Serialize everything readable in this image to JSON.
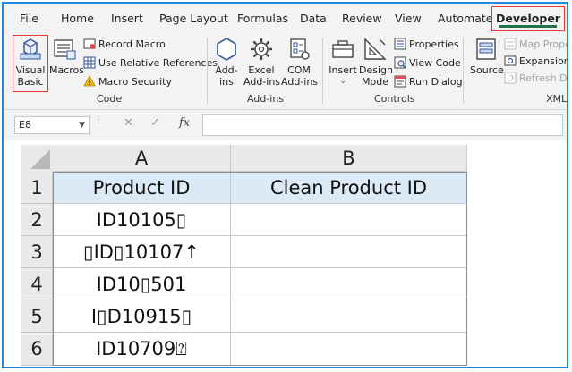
{
  "ribbon_tabs": [
    "File",
    "Home",
    "Insert",
    "Page Layout",
    "Formulas",
    "Data",
    "Review",
    "View",
    "Automate",
    "Developer"
  ],
  "active_tab": "Developer",
  "code_group": {
    "label": "Code",
    "visual_basic": "Visual\nBasic",
    "macros": "Macros",
    "record_macro": "Record Macro",
    "use_relative_references": "Use Relative References",
    "macro_security": "Macro Security"
  },
  "addins_group": {
    "label": "Add-ins",
    "addins": "Add-\nins",
    "excel_addins": "Excel\nAdd-ins",
    "com_addins": "COM\nAdd-ins"
  },
  "controls_group": {
    "label": "Controls",
    "insert": "Insert",
    "design_mode": "Design\nMode",
    "properties": "Properties",
    "view_code": "View Code",
    "run_dialog": "Run Dialog"
  },
  "xml_group": {
    "label": "XML",
    "source": "Source",
    "map_properties": "Map Proper",
    "expansion_packs": "Expansion P",
    "refresh_data": "Refresh Dat"
  },
  "name_box": "E8",
  "formula_icons": {
    "cancel": "✕",
    "enter": "✓",
    "fx": "fx"
  },
  "formula_value": "",
  "columns": [
    "A",
    "B"
  ],
  "row_numbers": [
    "1",
    "2",
    "3",
    "4",
    "5",
    "6"
  ],
  "rows": [
    [
      "Product ID",
      "Clean Product ID"
    ],
    [
      "ID10105▯",
      ""
    ],
    [
      "▯ID▯10107↑",
      ""
    ],
    [
      "ID10▯501",
      ""
    ],
    [
      "I▯D10915▯",
      ""
    ],
    [
      "ID10709⍰",
      ""
    ]
  ],
  "colors": {
    "accent": "#217346",
    "highlight": "#e53935",
    "header_fill": "#dce9f7",
    "frame": "#1e88e5"
  }
}
